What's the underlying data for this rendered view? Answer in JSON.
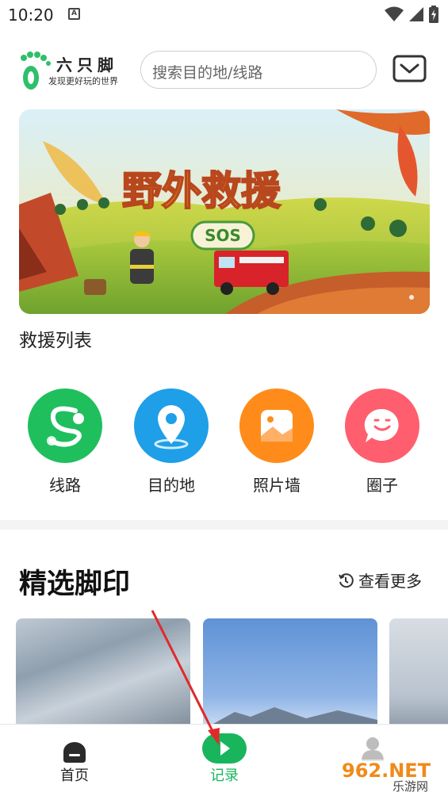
{
  "status_bar": {
    "time": "10:20",
    "notification_letter": "A"
  },
  "header": {
    "logo_name": "六只脚",
    "logo_slogan": "发现更好玩的世界",
    "search_placeholder": "搜索目的地/线路"
  },
  "banner": {
    "headline": "野外救援",
    "badge": "SOS"
  },
  "rescue_list_title": "救援列表",
  "quick_nav": [
    {
      "label": "线路",
      "color": "#1fbf5e"
    },
    {
      "label": "目的地",
      "color": "#1e9fe8"
    },
    {
      "label": "照片墙",
      "color": "#ff8c1a"
    },
    {
      "label": "圈子",
      "color": "#ff5e6e"
    }
  ],
  "featured": {
    "title": "精选脚印",
    "more": "查看更多"
  },
  "bottom_nav": [
    {
      "label": "首页"
    },
    {
      "label": "记录"
    },
    {
      "label": "我的"
    }
  ],
  "watermark": {
    "brand": "962.NET",
    "subtitle": "乐游网"
  },
  "colors": {
    "accent": "#19b55c",
    "text": "#222222"
  }
}
